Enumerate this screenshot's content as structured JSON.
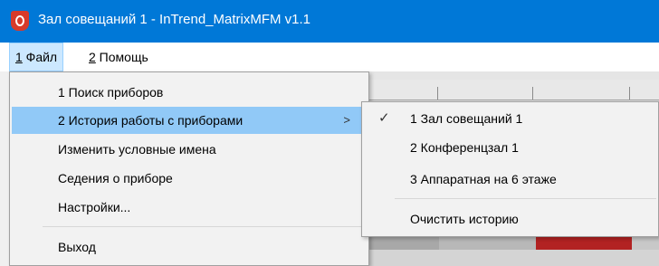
{
  "window": {
    "title": "Зал совещаний 1 - InTrend_MatrixMFM v1.1",
    "accent_color": "#0078d7",
    "app_icon": "intrend-app-icon"
  },
  "menubar": {
    "file_num": "1",
    "file_label": " Файл",
    "help_num": "2",
    "help_label": " Помощь"
  },
  "file_menu": {
    "items": [
      {
        "label": "1 Поиск приборов"
      },
      {
        "label": "2 История работы с приборами",
        "submenu_icon": "chevron-right-icon",
        "arrow": ">"
      },
      {
        "label": "Изменить условные имена"
      },
      {
        "label": "Седения о приборе"
      },
      {
        "label": "Настройки..."
      },
      {
        "label": "Выход"
      }
    ]
  },
  "history_submenu": {
    "check_glyph": "✓",
    "items": [
      {
        "label": "1 Зал совещаний 1",
        "checked": true
      },
      {
        "label": "2 Конференцзал 1"
      },
      {
        "label": "3 Аппаратная на 6 этаже"
      },
      {
        "label": "Очистить историю"
      }
    ]
  },
  "colors": {
    "highlight": "#91c9f7",
    "menu_bg": "#f2f2f2",
    "red_indicator": "#b22222"
  }
}
